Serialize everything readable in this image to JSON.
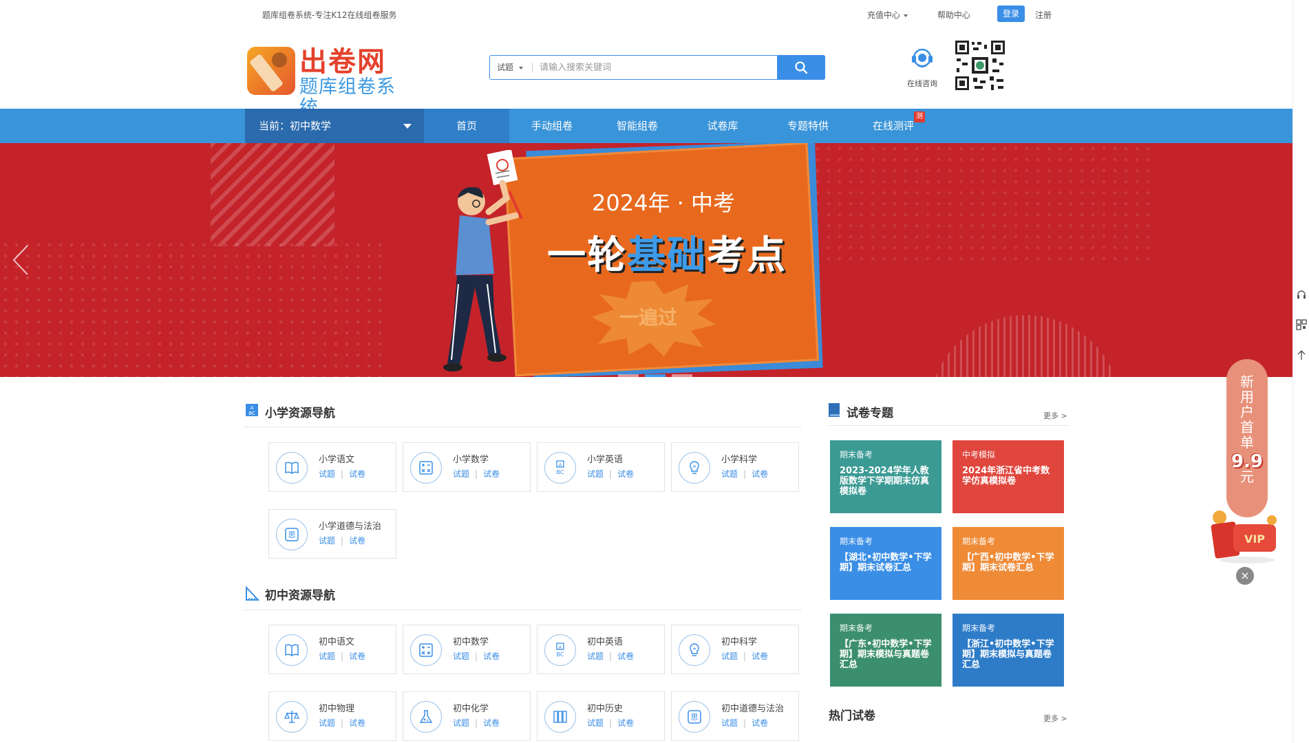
{
  "topbar": {
    "slogan": "题库组卷系统-专注K12在线组卷服务",
    "recharge": "充值中心",
    "help": "帮助中心",
    "login": "登录",
    "register": "注册"
  },
  "logo": {
    "name": "出卷网",
    "sub": "题库组卷系统"
  },
  "search": {
    "type": "试题",
    "placeholder": "请输入搜索关键词"
  },
  "consult": {
    "label": "在线咨询"
  },
  "nav": {
    "current": "当前：初中数学",
    "items": [
      "首页",
      "手动组卷",
      "智能组卷",
      "试卷库",
      "专题特供",
      "在线测评"
    ],
    "badge": "测"
  },
  "banner": {
    "year": "2024年 · 中考",
    "headline_a": "一轮",
    "headline_b": "基础",
    "headline_c": "考点",
    "burst": "一遍过"
  },
  "primary": {
    "title": "小学资源导航",
    "subjects": [
      {
        "name": "小学语文",
        "q": "试题",
        "p": "试卷",
        "icon": "book-icon"
      },
      {
        "name": "小学数学",
        "q": "试题",
        "p": "试卷",
        "icon": "calculator-icon"
      },
      {
        "name": "小学英语",
        "q": "试题",
        "p": "试卷",
        "icon": "abc-icon"
      },
      {
        "name": "小学科学",
        "q": "试题",
        "p": "试卷",
        "icon": "bulb-icon"
      },
      {
        "name": "小学道德与法治",
        "q": "试题",
        "p": "试卷",
        "icon": "think-icon"
      }
    ]
  },
  "middle": {
    "title": "初中资源导航",
    "subjects": [
      {
        "name": "初中语文",
        "q": "试题",
        "p": "试卷",
        "icon": "book-icon"
      },
      {
        "name": "初中数学",
        "q": "试题",
        "p": "试卷",
        "icon": "calculator-icon"
      },
      {
        "name": "初中英语",
        "q": "试题",
        "p": "试卷",
        "icon": "abc-icon"
      },
      {
        "name": "初中科学",
        "q": "试题",
        "p": "试卷",
        "icon": "bulb-icon"
      },
      {
        "name": "初中物理",
        "q": "试题",
        "p": "试卷",
        "icon": "scale-icon"
      },
      {
        "name": "初中化学",
        "q": "试题",
        "p": "试卷",
        "icon": "flask-icon"
      },
      {
        "name": "初中历史",
        "q": "试题",
        "p": "试卷",
        "icon": "history-icon"
      },
      {
        "name": "初中道德与法治",
        "q": "试题",
        "p": "试卷",
        "icon": "think-icon"
      }
    ]
  },
  "topics": {
    "title": "试卷专题",
    "more": "更多 >",
    "tiles": [
      {
        "cat": "期末备考",
        "title": "2023-2024学年人教版数学下学期期末仿真模拟卷",
        "color": "#3b9a94"
      },
      {
        "cat": "中考模拟",
        "title": "2024年浙江省中考数学仿真模拟卷",
        "color": "#e0463d"
      },
      {
        "cat": "期末备考",
        "title": "【湖北•初中数学•下学期】期末试卷汇总",
        "color": "#3a8ee6"
      },
      {
        "cat": "期末备考",
        "title": "【广西•初中数学•下学期】期末试卷汇总",
        "color": "#ef8b37"
      },
      {
        "cat": "期末备考",
        "title": "【广东•初中数学•下学期】期末模拟与真题卷汇总",
        "color": "#3c8f6e"
      },
      {
        "cat": "期末备考",
        "title": "【浙江•初中数学•下学期】期末模拟与真题卷汇总",
        "color": "#2e7cc8"
      }
    ]
  },
  "hot": {
    "title": "热门试卷",
    "more": "更多 >"
  },
  "promo": {
    "l1": "新",
    "l2": "用",
    "l3": "户",
    "l4": "首",
    "l5": "单",
    "price": "9.9",
    "unit": "元",
    "vip": "VIP",
    "close": "×"
  }
}
